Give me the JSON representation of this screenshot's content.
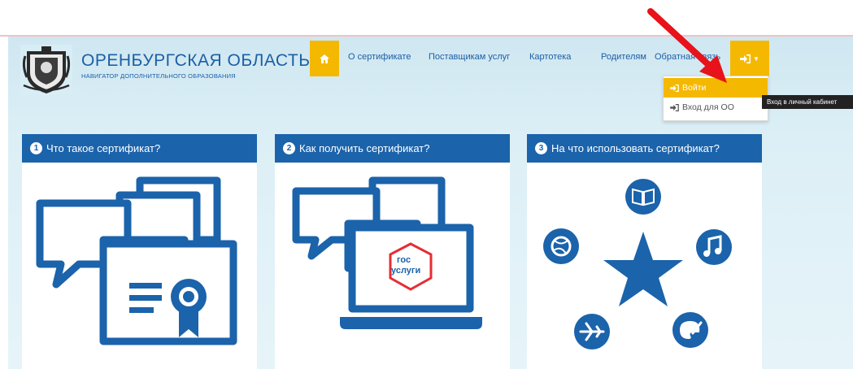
{
  "header": {
    "region_title": "ОРЕНБУРГСКАЯ ОБЛАСТЬ",
    "region_subtitle": "НАВИГАТОР ДОПОЛНИТЕЛЬНОГО ОБРАЗОВАНИЯ"
  },
  "nav": {
    "items": [
      "О сертификате",
      "Поставщикам услуг",
      "Картотека",
      "Родителям",
      "Обратная связь"
    ]
  },
  "login_menu": {
    "items": [
      "Войти",
      "Вход для ОО"
    ],
    "tooltip": "Вход в личный кабинет"
  },
  "cards": [
    {
      "number": "1",
      "title": "Что такое сертификат?"
    },
    {
      "number": "2",
      "title": "Как получить сертификат?",
      "logo_text": [
        "гос",
        "услуги"
      ]
    },
    {
      "number": "3",
      "title": "На что использовать сертификат?"
    }
  ],
  "icons": {
    "nav_home": "home-icon",
    "login": "sign-in-icon",
    "caret": "chevron-down-icon",
    "card_numbers": "numbered-circle-icon",
    "card1": "certificate-chat-icon",
    "card2": "laptop-gosuslugi-icon",
    "card3": [
      "book-icon",
      "music-icon",
      "palette-icon",
      "plane-icon",
      "volleyball-icon",
      "star-icon"
    ]
  },
  "colors": {
    "brand_blue": "#1b63ab",
    "accent_yellow": "#f5b800",
    "arrow_red": "#e8121a",
    "gosuslugi_red": "#e52d34",
    "header_bg": "#d8edf5"
  }
}
